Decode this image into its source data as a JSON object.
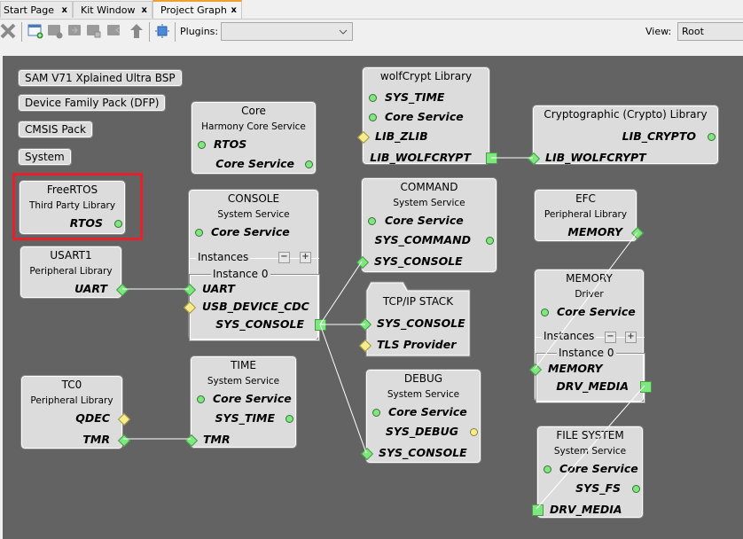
{
  "tabs": [
    {
      "label": "Start Page",
      "active": false
    },
    {
      "label": "Kit Window",
      "active": false
    },
    {
      "label": "Project Graph",
      "active": true
    }
  ],
  "tab_close_glyph": "x",
  "toolbar": {
    "icons": [
      "delete-icon",
      "add-container-icon",
      "remove-container-icon",
      "move-into-container-icon",
      "container-checked-icon",
      "move-out-container-icon",
      "move-up-icon",
      "fit-to-window-icon"
    ],
    "plugins_label": "Plugins:",
    "plugins_value": "",
    "view_label": "View:",
    "view_value": "Root"
  },
  "pills": [
    "SAM V71 Xplained Ultra BSP",
    "Device Family Pack (DFP)",
    "CMSIS Pack",
    "System"
  ],
  "nodes": {
    "freertos": {
      "title": "FreeRTOS",
      "subtitle": "Third Party Library",
      "deps": [
        "RTOS"
      ]
    },
    "core": {
      "title": "Core",
      "subtitle": "Harmony Core Service",
      "deps": [
        "RTOS",
        "Core Service"
      ]
    },
    "wolfcrypt": {
      "title": "wolfCrypt Library",
      "deps": [
        "SYS_TIME",
        "Core Service",
        "LIB_ZLIB",
        "LIB_WOLFCRYPT"
      ]
    },
    "crypto": {
      "title": "Cryptographic (Crypto) Library",
      "deps": [
        "LIB_CRYPTO",
        "LIB_WOLFCRYPT"
      ]
    },
    "usart1": {
      "title": "USART1",
      "subtitle": "Peripheral Library",
      "deps": [
        "UART"
      ]
    },
    "console": {
      "title": "CONSOLE",
      "subtitle": "System Service",
      "deps": [
        "Core Service",
        "UART",
        "USB_DEVICE_CDC",
        "SYS_CONSOLE"
      ],
      "instances_label": "Instances",
      "instance_label": "Instance 0"
    },
    "command": {
      "title": "COMMAND",
      "subtitle": "System Service",
      "deps": [
        "Core Service",
        "SYS_COMMAND",
        "SYS_CONSOLE"
      ]
    },
    "tcpip": {
      "title": "TCP/IP STACK",
      "deps": [
        "SYS_CONSOLE",
        "TLS Provider"
      ]
    },
    "efc": {
      "title": "EFC",
      "subtitle": "Peripheral Library",
      "deps": [
        "MEMORY"
      ]
    },
    "memory": {
      "title": "MEMORY",
      "subtitle": "Driver",
      "deps": [
        "Core Service",
        "MEMORY",
        "DRV_MEDIA"
      ],
      "instances_label": "Instances",
      "instance_label": "Instance 0"
    },
    "time": {
      "title": "TIME",
      "subtitle": "System Service",
      "deps": [
        "Core Service",
        "SYS_TIME",
        "TMR"
      ]
    },
    "tc0": {
      "title": "TC0",
      "subtitle": "Peripheral Library",
      "deps": [
        "QDEC",
        "TMR"
      ]
    },
    "debug": {
      "title": "DEBUG",
      "subtitle": "System Service",
      "deps": [
        "Core Service",
        "SYS_DEBUG",
        "SYS_CONSOLE"
      ]
    },
    "filesystem": {
      "title": "FILE SYSTEM",
      "subtitle": "System Service",
      "deps": [
        "Core Service",
        "SYS_FS",
        "DRV_MEDIA"
      ]
    }
  },
  "colors": {
    "canvas": "#636363",
    "node_bg": "#dcdcdc",
    "satisfied": "#7de87d",
    "optional": "#f6ec8c",
    "highlight": "#e8202a"
  }
}
